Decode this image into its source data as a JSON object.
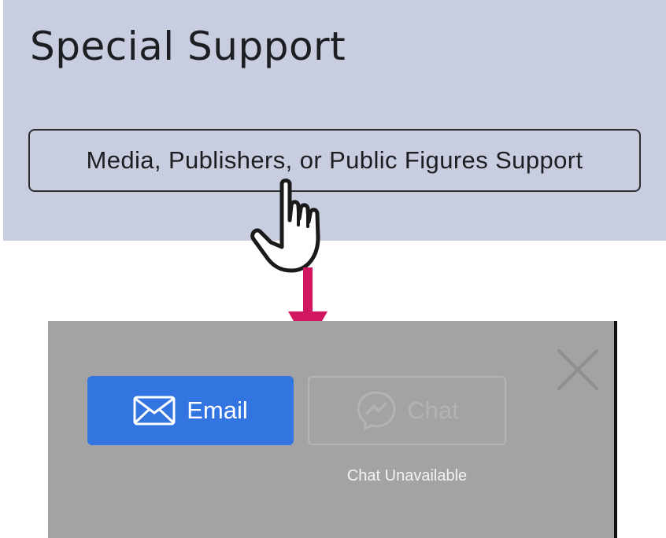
{
  "special_support": {
    "title": "Special Support",
    "button_label": "Media, Publishers, or Public Figures Support"
  },
  "contact_modal": {
    "email_label": "Email",
    "chat_label": "Chat",
    "chat_status": "Chat Unavailable"
  },
  "icons": {
    "pointer": "hand-pointer-icon",
    "arrow": "arrow-down-icon",
    "close": "close-icon",
    "email": "envelope-icon",
    "chat": "messenger-icon"
  },
  "colors": {
    "panel_background": "#c8cddf",
    "modal_background": "#a3a3a3",
    "email_button": "#3375e0",
    "arrow": "#d1175f",
    "disabled": "#b3b3b3"
  }
}
